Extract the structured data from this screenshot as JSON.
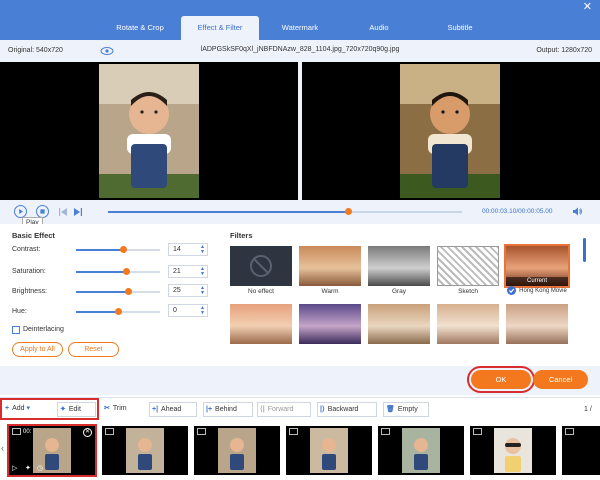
{
  "tabs": [
    {
      "label": "Rotate & Crop",
      "active": false
    },
    {
      "label": "Effect & Filter",
      "active": true
    },
    {
      "label": "Watermark",
      "active": false
    },
    {
      "label": "Audio",
      "active": false
    },
    {
      "label": "Subtitle",
      "active": false
    }
  ],
  "preview": {
    "original": "Original: 540x720",
    "filename": "lADPGSkSF0qXl_jNBFDNAzw_828_1104.jpg_720x720q90g.jpg",
    "output": "Output: 1280x720"
  },
  "playback": {
    "tooltip": "Play",
    "timecode": "00:00:03.10/00:00:05.00",
    "progress": 0.68
  },
  "basic_effect": {
    "title": "Basic Effect",
    "params": [
      {
        "label": "Contrast:",
        "value": "14",
        "level": 0.57
      },
      {
        "label": "Saturation:",
        "value": "21",
        "level": 0.6
      },
      {
        "label": "Brightness:",
        "value": "25",
        "level": 0.62
      },
      {
        "label": "Hue:",
        "value": "0",
        "level": 0.5
      }
    ],
    "deinterlacing": "Deinterlacing",
    "apply_all": "Apply to All",
    "reset": "Reset"
  },
  "filters": {
    "title": "Filters",
    "items": [
      "No effect",
      "Warm",
      "Gray",
      "Sketch",
      "Hong Kong Movie"
    ],
    "current_badge": "Current",
    "selected": "Hong Kong Movie"
  },
  "actions": {
    "ok": "OK",
    "cancel": "Cancel"
  },
  "toolbar": {
    "add": "Add",
    "edit": "Edit",
    "trim": "Trim",
    "ahead": "Ahead",
    "behind": "Behind",
    "forward": "Forward",
    "backward": "Backward",
    "empty": "Empty",
    "page": "1 /"
  },
  "filmstrip": {
    "first_clip_time": "00:"
  },
  "colors": {
    "accent_blue": "#4a7fd6",
    "accent_orange": "#f3781e",
    "highlight_red": "#d92d2d"
  }
}
